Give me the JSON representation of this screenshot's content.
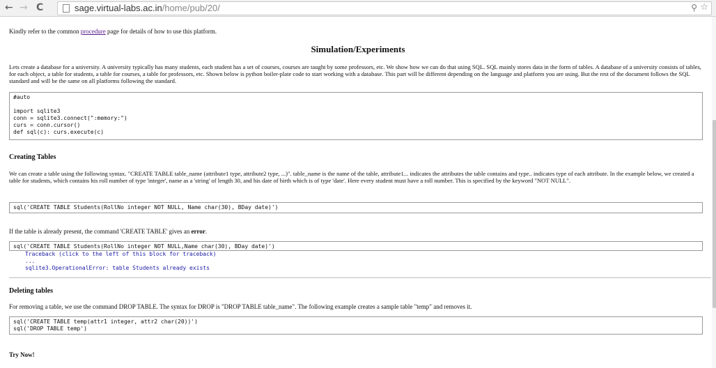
{
  "browser": {
    "back_icon": "←",
    "forward_icon": "→",
    "reload_icon": "C",
    "url_host": "sage.virtual-labs.ac.in",
    "url_path": "/home/pub/20/"
  },
  "page": {
    "intro_prefix": "Kindly refer to the common ",
    "intro_link": "procedure",
    "intro_suffix": " page for details of how to use this platform.",
    "section_title": "Simulation/Experiments",
    "intro_paragraph": "Lets create a database for a university. A university typically has many students, each student has a set of courses, courses are taught by some professors, etc. We show how we can do that using SQL. SQL mainly stores data in the form of tables. A database of a university consists of tables, for each object, a table for students, a table for courses, a table for professors, etc. Shown below is python boiler-plate code to start working with a database. This part will be different depending on the language and platform you are using. But the rest of the document follows the SQL standard and will be the same on all platforms following the standard.",
    "code_setup": "#auto\n\nimport sqlite3\nconn = sqlite3.connect(\":memory:\")\ncurs = conn.cursor()\ndef sql(c): curs.execute(c)",
    "creating_heading": "Creating Tables",
    "creating_paragraph": "We can create a table using the following syntax. \"CREATE TABLE table_name (attribute1 type, attribute2 type, ...)\". table_name is the name of the table, attribute1... indicates the attributes the table contains and type.. indicates type of each attribute. In the example below, we created a table for students, which contains his roll number of type 'integer', name as a 'string' of length 30, and his date of birth which is of type 'date'. Here every student must have a roll number. This is specified by the keyword \"NOT NULL\".",
    "code_create": "sql('CREATE TABLE Students(RollNo integer NOT NULL, Name char(30), BDay date)')",
    "already_prefix": "If the table is already present, the command 'CREATE TABLE' gives an ",
    "already_bold": "error",
    "already_suffix": ".",
    "code_create_again": "sql('CREATE TABLE Students(RollNo integer NOT NULL,Name char(30), BDay date)')",
    "traceback": "Traceback (click to the left of this block for traceback)\n...\nsqlite3.OperationalError: table Students already exists",
    "deleting_heading": "Deleting tables",
    "deleting_paragraph": "For removing a table, we use the command DROP TABLE. The syntax for DROP is \"DROP TABLE table_name\". The following example creates a sample table \"temp\" and removes it.",
    "code_drop": "sql('CREATE TABLE temp(attr1 integer, attr2 char(20))')\nsql('DROP TABLE temp')",
    "try_now": "Try Now!"
  }
}
